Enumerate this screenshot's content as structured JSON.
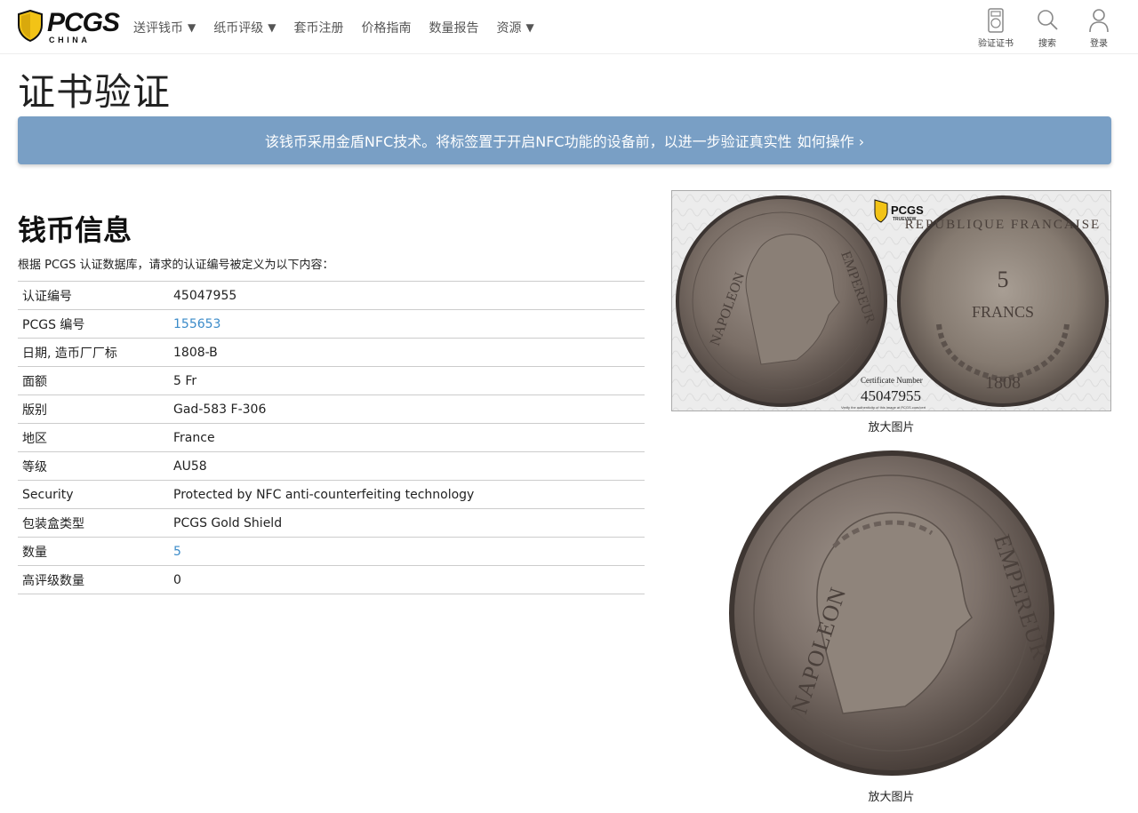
{
  "header": {
    "logo_text": "PCGS",
    "logo_sub": "CHINA",
    "nav": [
      {
        "label": "送评钱币",
        "dropdown": true
      },
      {
        "label": "纸币评级",
        "dropdown": true
      },
      {
        "label": "套币注册",
        "dropdown": false
      },
      {
        "label": "价格指南",
        "dropdown": false
      },
      {
        "label": "数量报告",
        "dropdown": false
      },
      {
        "label": "资源",
        "dropdown": true
      }
    ],
    "caret": "▼",
    "tools": {
      "verify": "验证证书",
      "search": "搜索",
      "login": "登录"
    }
  },
  "page_title": "证书验证",
  "banner": {
    "text": "该钱币采用金盾NFC技术。将标签置于开启NFC功能的设备前，以进一步验证真实性",
    "link": "如何操作",
    "chevron": "›"
  },
  "coin_info": {
    "title": "钱币信息",
    "intro": "根据 PCGS 认证数据库，请求的认证编号被定义为以下内容：",
    "rows": [
      {
        "label": "认证编号",
        "value": "45047955",
        "link": false
      },
      {
        "label": "PCGS 编号",
        "value": "155653",
        "link": true
      },
      {
        "label": "日期, 造币厂厂标",
        "value": "1808-B",
        "link": false
      },
      {
        "label": "面额",
        "value": "5 Fr",
        "link": false
      },
      {
        "label": "版别",
        "value": "Gad-583 F-306",
        "link": false
      },
      {
        "label": "地区",
        "value": "France",
        "link": false
      },
      {
        "label": "等级",
        "value": "AU58",
        "link": false
      },
      {
        "label": "Security",
        "value": "Protected by NFC anti-counterfeiting technology",
        "link": false
      },
      {
        "label": "包装盒类型",
        "value": "PCGS Gold Shield",
        "link": false
      },
      {
        "label": "数量",
        "value": "5",
        "link": true
      },
      {
        "label": "高评级数量",
        "value": "0",
        "link": false
      }
    ]
  },
  "slab_image": {
    "trueview_brand": "PCGS",
    "trueview_sub": "TRUEVIEW",
    "cert_label": "Certificate Number",
    "cert_number": "45047955",
    "verify_note": "Verify the authenticity of this image at PCGS.com/cert",
    "obverse_legend_left": "NAPOLEON",
    "obverse_legend_right": "EMPEREUR",
    "reverse_legend": "REPUBLIQUE FRANCAISE",
    "reverse_value": "5",
    "reverse_unit": "FRANCS",
    "reverse_year": "1808",
    "caption": "放大图片"
  },
  "coin_image": {
    "legend_left": "NAPOLEON",
    "legend_right": "EMPEREUR",
    "caption": "放大图片"
  },
  "colors": {
    "banner_bg": "#799fc5",
    "link": "#3b8bc9",
    "shield_gold": "#f2c316"
  }
}
